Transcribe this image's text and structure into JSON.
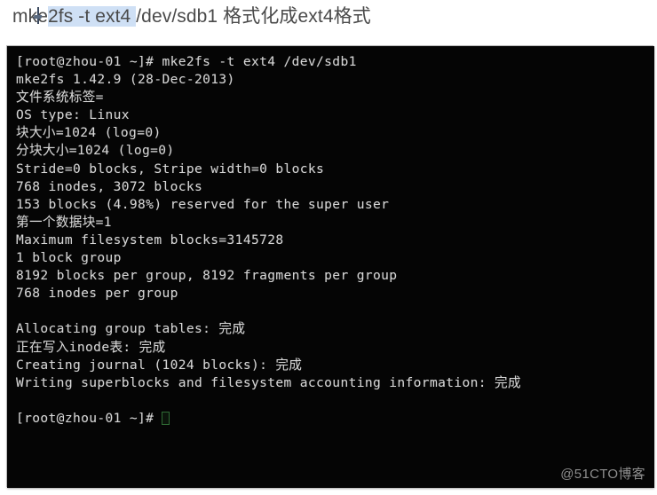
{
  "heading": {
    "prefix": "mke",
    "selected": "2fs -t ext4 ",
    "suffix": "/dev/sdb1 格式化成ext4格式",
    "full_text": "mke2fs -t ext4 /dev/sdb1 格式化成ext4格式",
    "selection_color": "#cfe0f5",
    "text_color": "#4a4a4a"
  },
  "terminal": {
    "background_color": "#050505",
    "text_color": "#d6d6d6",
    "cursor_color": "#2f6b34",
    "prompt": "[root@zhou-01 ~]#",
    "lines": [
      "[root@zhou-01 ~]# mke2fs -t ext4 /dev/sdb1",
      "mke2fs 1.42.9 (28-Dec-2013)",
      "文件系统标签=",
      "OS type: Linux",
      "块大小=1024 (log=0)",
      "分块大小=1024 (log=0)",
      "Stride=0 blocks, Stripe width=0 blocks",
      "768 inodes, 3072 blocks",
      "153 blocks (4.98%) reserved for the super user",
      "第一个数据块=1",
      "Maximum filesystem blocks=3145728",
      "1 block group",
      "8192 blocks per group, 8192 fragments per group",
      "768 inodes per group",
      "",
      "Allocating group tables: 完成",
      "正在写入inode表: 完成",
      "Creating journal (1024 blocks): 完成",
      "Writing superblocks and filesystem accounting information: 完成",
      "",
      "[root@zhou-01 ~]# "
    ],
    "cursor_line_index": 20
  },
  "watermark": {
    "text": "@51CTO博客",
    "color": "#8f8f8f"
  }
}
